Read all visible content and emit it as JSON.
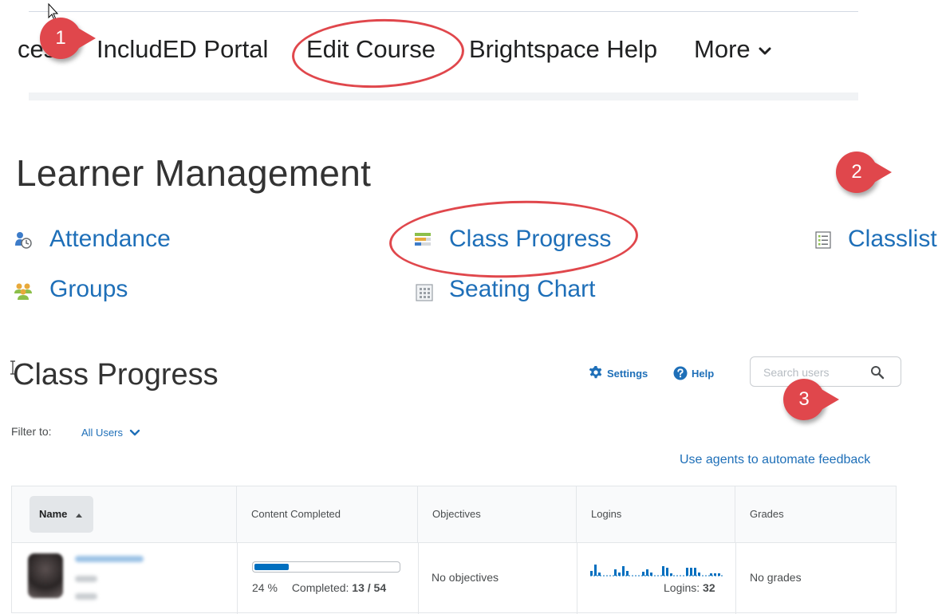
{
  "nav": {
    "cut_item": "ces",
    "items": [
      "IncludED Portal",
      "Edit Course",
      "Brightspace Help",
      "More"
    ]
  },
  "badges": [
    "1",
    "2",
    "3"
  ],
  "learner_management": {
    "title": "Learner Management",
    "links": {
      "attendance": "Attendance",
      "class_progress": "Class Progress",
      "classlist": "Classlist",
      "groups": "Groups",
      "seating_chart": "Seating Chart"
    }
  },
  "class_progress": {
    "title": "Class Progress",
    "settings": "Settings",
    "help": "Help",
    "search_placeholder": "Search users",
    "filter_label": "Filter to:",
    "filter_value": "All Users",
    "agents_link": "Use agents to automate feedback"
  },
  "table": {
    "columns": [
      "Name",
      "Content Completed",
      "Objectives",
      "Logins",
      "Grades"
    ],
    "row": {
      "progress_percent": 24,
      "percent_text": "24 %",
      "completed_label": "Completed:",
      "completed_value": "13 / 54",
      "objectives": "No objectives",
      "logins_label": "Logins:",
      "logins_value": "32",
      "grades": "No grades"
    }
  },
  "colors": {
    "link": "#1e6fb8",
    "annotation": "#e0474c",
    "progress": "#006fbf"
  }
}
